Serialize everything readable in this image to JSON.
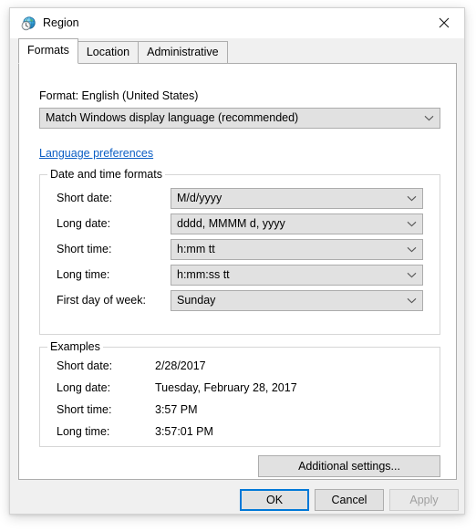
{
  "window": {
    "title": "Region",
    "icon": "region-globe-clock-icon",
    "close_label": "✕"
  },
  "tabs": [
    {
      "label": "Formats",
      "active": true
    },
    {
      "label": "Location",
      "active": false
    },
    {
      "label": "Administrative",
      "active": false
    }
  ],
  "format": {
    "label": "Format: English (United States)",
    "combo_value": "Match Windows display language (recommended)",
    "language_preferences_link": "Language preferences"
  },
  "datetime_group": {
    "title": "Date and time formats",
    "rows": [
      {
        "label": "Short date:",
        "value": "M/d/yyyy"
      },
      {
        "label": "Long date:",
        "value": "dddd, MMMM d, yyyy"
      },
      {
        "label": "Short time:",
        "value": "h:mm tt"
      },
      {
        "label": "Long time:",
        "value": "h:mm:ss tt"
      },
      {
        "label": "First day of week:",
        "value": "Sunday"
      }
    ]
  },
  "examples_group": {
    "title": "Examples",
    "rows": [
      {
        "label": "Short date:",
        "value": "2/28/2017"
      },
      {
        "label": "Long date:",
        "value": "Tuesday, February 28, 2017"
      },
      {
        "label": "Short time:",
        "value": "3:57 PM"
      },
      {
        "label": "Long time:",
        "value": "3:57:01 PM"
      }
    ]
  },
  "buttons": {
    "additional_settings": "Additional settings...",
    "ok": "OK",
    "cancel": "Cancel",
    "apply": "Apply"
  },
  "colors": {
    "accent": "#0078d7",
    "link": "#0b5ec4",
    "window_bg": "#f0f0f0",
    "page_bg": "#ffffff",
    "control_bg": "#e1e1e1",
    "disabled_text": "#a0a0a0"
  }
}
